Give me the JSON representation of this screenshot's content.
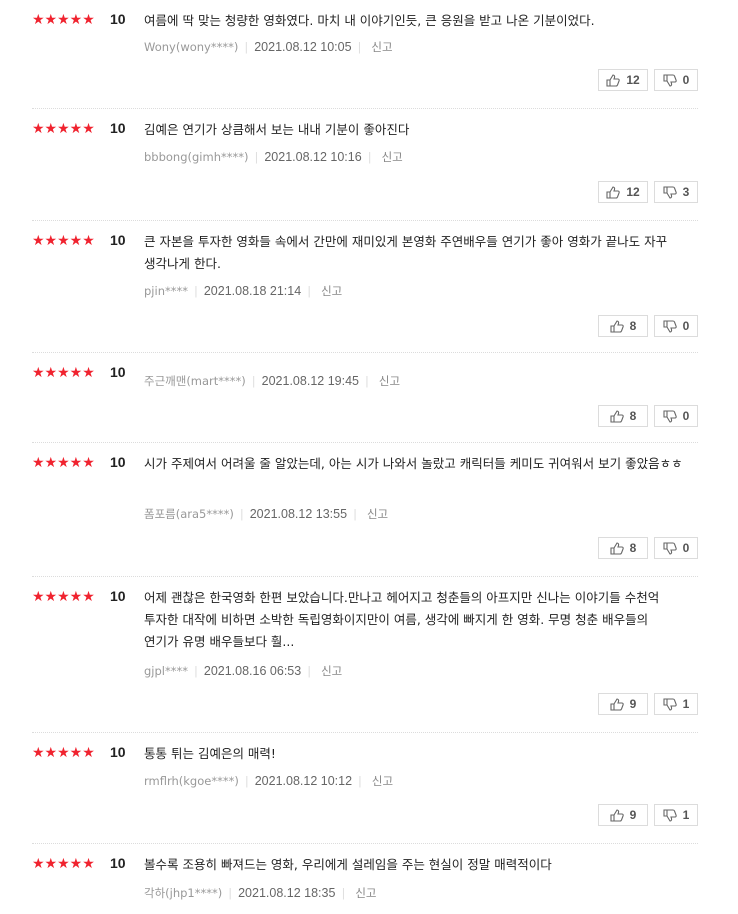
{
  "reviews": [
    {
      "stars": "★★★★★",
      "score": "10",
      "text": "여름에 딱 맞는 청량한 영화였다. 마치 내 이야기인듯, 큰 응원을 받고 나온 기분이었다.",
      "author": "Wony(wony****)",
      "date": "2021.08.12 10:05",
      "report": "신고",
      "up": "12",
      "down": "0"
    },
    {
      "stars": "★★★★★",
      "score": "10",
      "text": "김예은 연기가 상큼해서 보는 내내 기분이 좋아진다",
      "author": "bbbong(gimh****)",
      "date": "2021.08.12 10:16",
      "report": "신고",
      "up": "12",
      "down": "3"
    },
    {
      "stars": "★★★★★",
      "score": "10",
      "text": "큰 자본을 투자한 영화들 속에서 간만에 재미있게 본영화 주연배우들 연기가 좋아 영화가 끝나도 자꾸 생각나게 한다.",
      "author": "pjin****",
      "date": "2021.08.18 21:14",
      "report": "신고",
      "up": "8",
      "down": "0"
    },
    {
      "stars": "★★★★★",
      "score": "10",
      "text": "",
      "author": "주근깨맨(mart****)",
      "date": "2021.08.12 19:45",
      "report": "신고",
      "up": "8",
      "down": "0"
    },
    {
      "stars": "★★★★★",
      "score": "10",
      "text": "시가 주제여서 어려울 줄 알았는데, 아는 시가 나와서 놀랐고 캐릭터들 케미도 귀여워서 보기 좋았음ㅎㅎ",
      "author": "폼포름(ara5****)",
      "date": "2021.08.12 13:55",
      "report": "신고",
      "up": "8",
      "down": "0"
    },
    {
      "stars": "★★★★★",
      "score": "10",
      "text": "어제 괜찮은 한국영화 한편 보았습니다.만나고 헤어지고 청춘들의 아프지만 신나는 이야기들 수천억 투자한 대작에 비하면 소박한 독립영화이지만이 여름, 생각에 빠지게 한 영화. 무명 청춘 배우들의 연기가 유명 배우들보다 훨...",
      "author": "gjpl****",
      "date": "2021.08.16 06:53",
      "report": "신고",
      "up": "9",
      "down": "1"
    },
    {
      "stars": "★★★★★",
      "score": "10",
      "text": "통통 튀는 김예은의 매력!",
      "author": "rmflrh(kgoe****)",
      "date": "2021.08.12 10:12",
      "report": "신고",
      "up": "9",
      "down": "1"
    },
    {
      "stars": "★★★★★",
      "score": "10",
      "text": "볼수록 조용히 빠져드는 영화, 우리에게 설레임을 주는 현실이 정말 매력적이다",
      "author": "각하(jhp1****)",
      "date": "2021.08.12 18:35",
      "report": "신고",
      "up": "",
      "down": ""
    }
  ],
  "colors": {
    "star": "#f0232f",
    "date": "#666666",
    "meta": "#999999"
  },
  "icons": {
    "up": "thumbs-up-icon",
    "down": "thumbs-down-icon",
    "star": "star-icon"
  }
}
